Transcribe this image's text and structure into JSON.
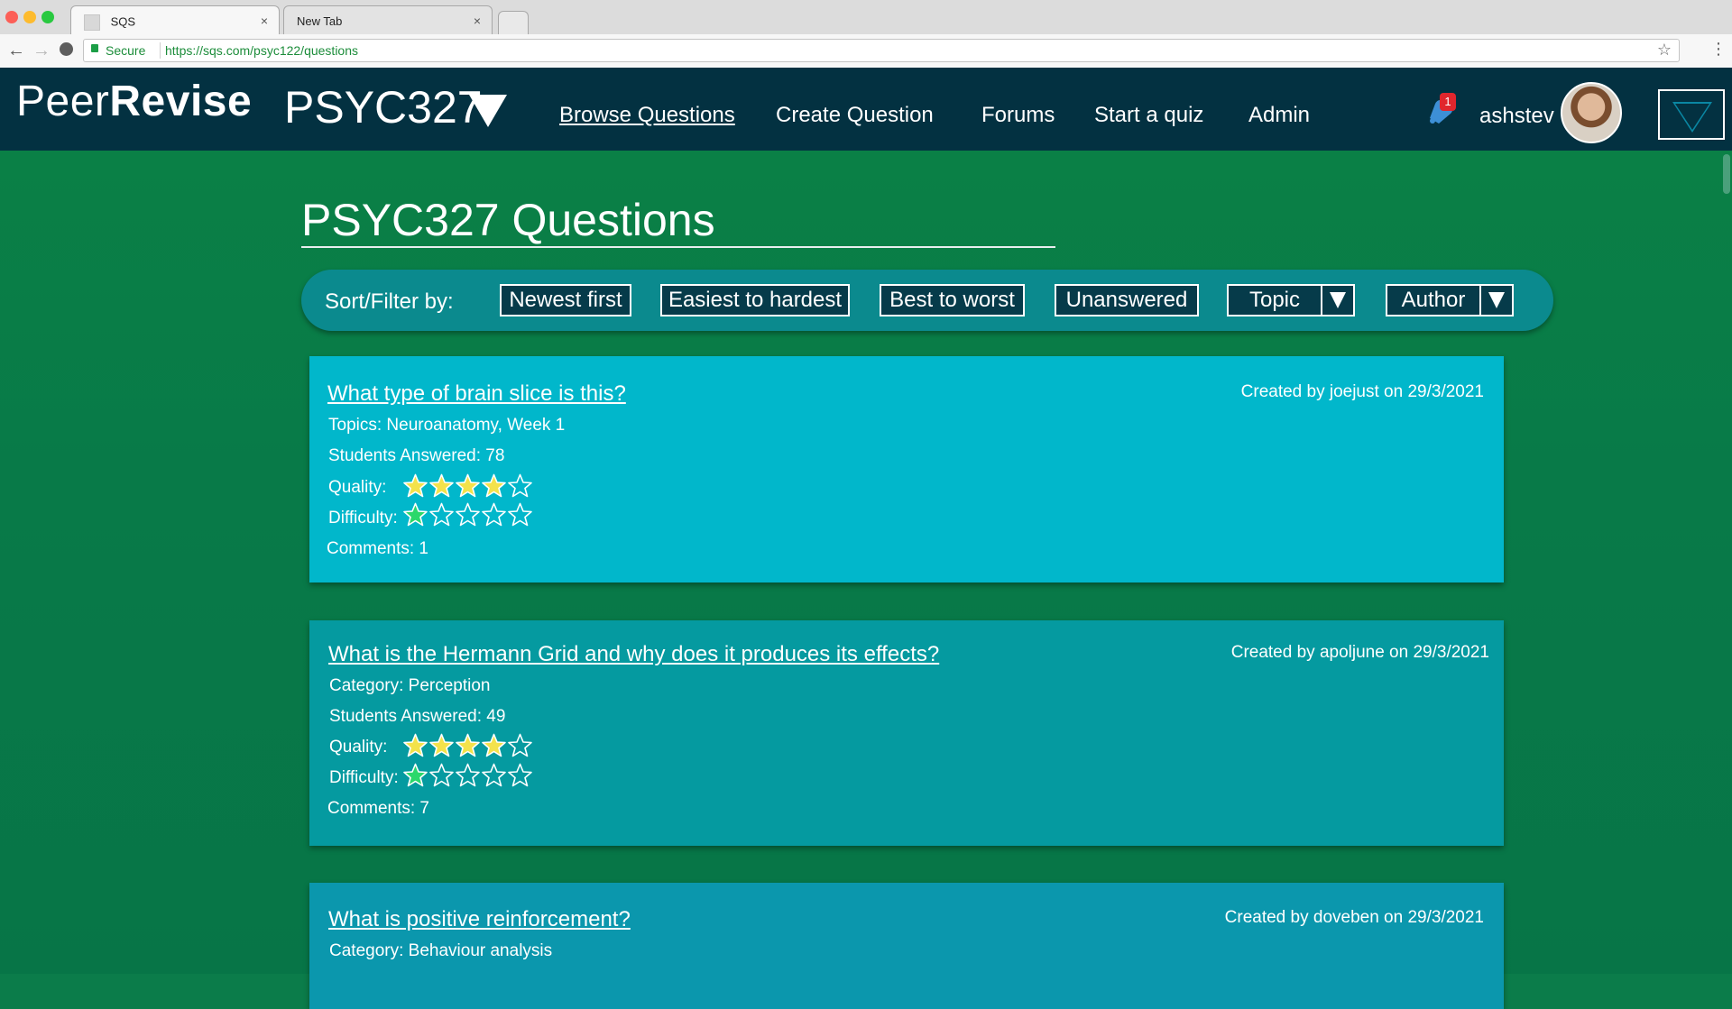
{
  "browser": {
    "tabs": [
      {
        "label": "SQS",
        "close": "×"
      },
      {
        "label": "New Tab",
        "close": "×"
      }
    ],
    "secure_label": "Secure",
    "url": "https://sqs.com/psyc122/questions"
  },
  "header": {
    "logo_part1": "Peer",
    "logo_part2": "Revise",
    "course": "PSYC327",
    "nav": [
      "Browse Questions",
      "Create Question",
      "Forums",
      "Start a quiz",
      "Admin"
    ],
    "notification_count": "1",
    "username": "ashstev"
  },
  "page": {
    "title": "PSYC327 Questions",
    "filter_label": "Sort/Filter by:",
    "filters": [
      "Newest first",
      "Easiest to hardest",
      "Best to worst",
      "Unanswered"
    ],
    "dropdowns": [
      "Topic",
      "Author"
    ]
  },
  "questions": [
    {
      "title": "What type of brain slice is this?",
      "created": "Created by joejust on 29/3/2021",
      "category": "Topics: Neuroanatomy, Week 1",
      "answered": "Students Answered: 78",
      "quality_label": "Quality:",
      "quality": 4,
      "difficulty_label": "Difficulty:",
      "difficulty": 1,
      "comments": "Comments: 1"
    },
    {
      "title": "What is the Hermann Grid and why does it produces its effects?",
      "created": "Created by apoljune on 29/3/2021",
      "category": "Category: Perception",
      "answered": "Students Answered: 49",
      "quality_label": "Quality:",
      "quality": 4,
      "difficulty_label": "Difficulty:",
      "difficulty": 1,
      "comments": "Comments: 7"
    },
    {
      "title": "What is positive reinforcement?",
      "created": "Created by doveben on 29/3/2021",
      "category": "Category:  Behaviour analysis"
    }
  ],
  "colors": {
    "header_bg": "#033141",
    "card1_bg": "#01b7cb",
    "card2_bg": "#059aa0",
    "card3_bg": "#0b97ad",
    "quality_star": "#f3e24b",
    "difficulty_star": "#2bd86b"
  }
}
